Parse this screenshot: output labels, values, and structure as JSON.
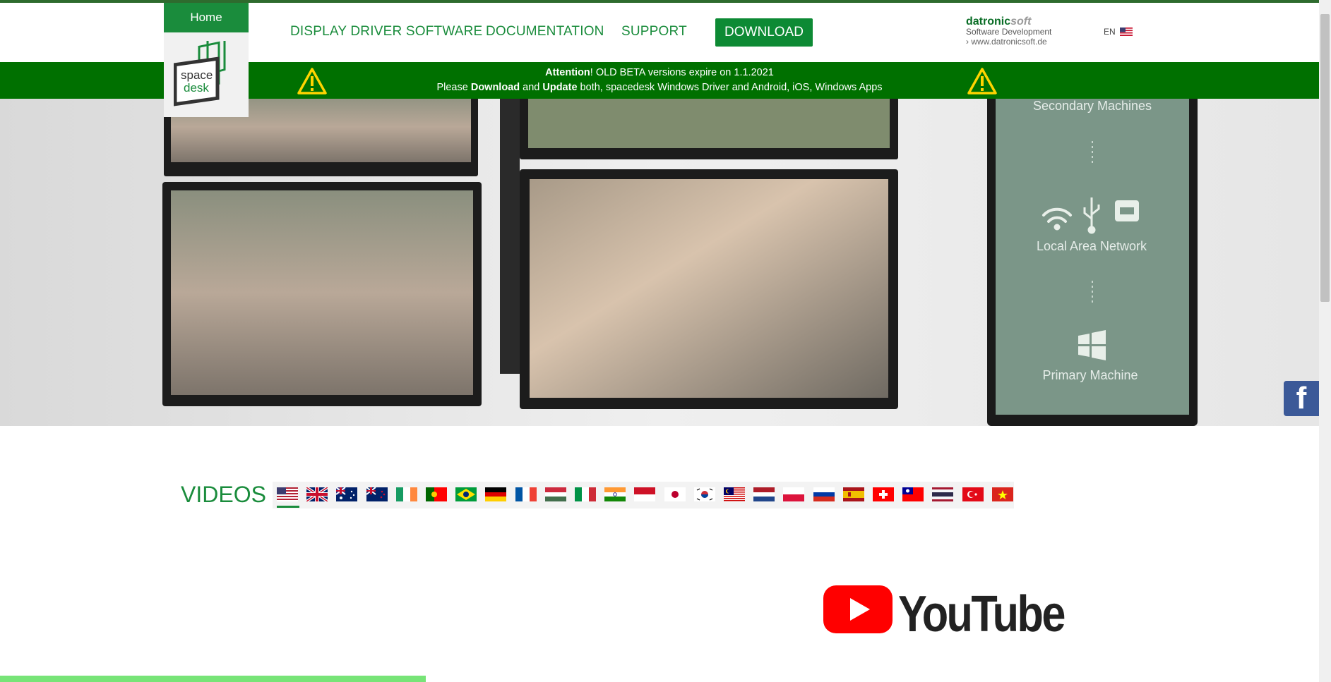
{
  "nav": {
    "home": "Home",
    "items": [
      "DISPLAY DRIVER SOFTWARE",
      "DOCUMENTATION",
      "SUPPORT"
    ],
    "download": "DOWNLOAD"
  },
  "logo": {
    "line1": "space",
    "line2": "desk"
  },
  "brand": {
    "name_main": "datronic",
    "name_accent": "soft",
    "tagline": "Software Development",
    "link": "www.datronicsoft.de"
  },
  "lang": {
    "code": "EN",
    "flag_icon": "us-flag-icon"
  },
  "banner": {
    "attention": "Attention",
    "line1_rest": "! OLD BETA versions expire on 1.1.2021",
    "please": "Please ",
    "download": "Download",
    "and": " and ",
    "update": "Update",
    "line2_rest": " both, spacedesk Windows Driver and Android, iOS, Windows Apps"
  },
  "hero": {
    "secondary": "Secondary Machines",
    "lan": "Local Area Network",
    "primary": "Primary Machine"
  },
  "videos": {
    "title": "VIDEOS",
    "flags": [
      "us",
      "gb",
      "au",
      "nz",
      "ie",
      "pt",
      "br",
      "de",
      "fr",
      "hu",
      "it",
      "in",
      "id",
      "jp",
      "kr",
      "my",
      "nl",
      "pl",
      "ru",
      "es",
      "ch",
      "tw",
      "th",
      "tr",
      "vn"
    ],
    "selected": "us"
  },
  "youtube": {
    "label": "YouTube"
  },
  "colors": {
    "green": "#1a8c3c",
    "banner": "#007000",
    "download_bg": "#0d8a34"
  }
}
